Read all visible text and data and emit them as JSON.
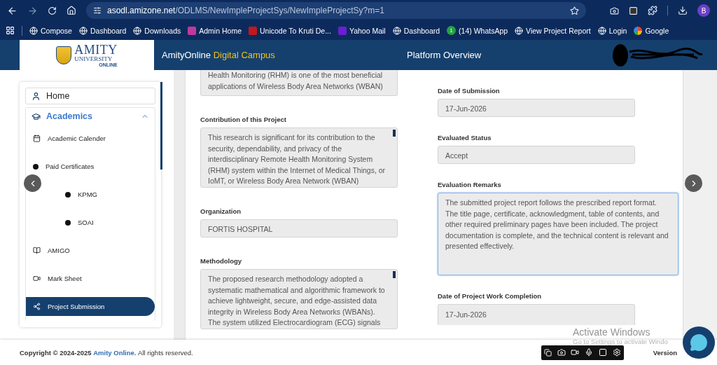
{
  "browser": {
    "url_host": "asodl.amizone.net",
    "url_path": "/ODLMS/NewImpleProjectSys/NewImpleProjectSy?m=1",
    "profile_initial": "B",
    "bookmarks": [
      {
        "label": "Compose",
        "kind": "globe"
      },
      {
        "label": "Dashboard",
        "kind": "globe"
      },
      {
        "label": "Downloads",
        "kind": "globe"
      },
      {
        "label": "Admin Home",
        "kind": "app",
        "color": "#c0399a"
      },
      {
        "label": "Unicode To Kruti De...",
        "kind": "app",
        "color": "#c0181e"
      },
      {
        "label": "Yahoo Mail",
        "kind": "app",
        "color": "#6a1fd1"
      },
      {
        "label": "Dashboard",
        "kind": "globe"
      },
      {
        "label": "(14) WhatsApp",
        "kind": "count",
        "badge": "1"
      },
      {
        "label": "View Project Report",
        "kind": "globe"
      },
      {
        "label": "Login",
        "kind": "globe"
      },
      {
        "label": "Google",
        "kind": "google"
      }
    ]
  },
  "header": {
    "logo_word": "AMITY",
    "logo_sub": "UNIVERSITY",
    "logo_tag": "ONLINE",
    "brand": "AmityOnline",
    "brand_accent": "Digital Campus",
    "title": "Platform Overview"
  },
  "sidebar": {
    "items": [
      {
        "label": "Home",
        "kind": "home",
        "selected": false
      },
      {
        "label": "Academics",
        "kind": "section",
        "selected": false,
        "expanded": true,
        "children": [
          {
            "label": "Academic Calender",
            "kind": "calendar",
            "selected": false
          },
          {
            "label": "Paid Certificates",
            "kind": "dot",
            "selected": false,
            "children": [
              {
                "label": "KPMG",
                "kind": "dot",
                "selected": false
              },
              {
                "label": "SOAI",
                "kind": "dot",
                "selected": false
              }
            ]
          },
          {
            "label": "AMIGO",
            "kind": "book",
            "selected": false
          },
          {
            "label": "Mark Sheet",
            "kind": "video",
            "selected": false
          },
          {
            "label": "Project Submission",
            "kind": "network",
            "selected": true
          }
        ]
      }
    ]
  },
  "form": {
    "left": [
      {
        "kind": "textarea",
        "cut_top": true,
        "lines": [
          "Health Monitoring (RHM) is one of the most beneficial",
          "applications of Wireless Body Area Networks (WBAN)"
        ]
      },
      {
        "kind": "textarea",
        "label": "Contribution of this Project",
        "scrollable": true,
        "lines": [
          "This research is significant for its contribution to the",
          "security, dependability, and privacy of the",
          "interdisciplinary Remote Health Monitoring System",
          "(RHM) system within the Internet of Medical Things, or",
          "IoMT, or Wireless Body Area Network (WBAN)"
        ]
      },
      {
        "kind": "text",
        "label": "Organization",
        "value": "FORTIS HOSPITAL"
      },
      {
        "kind": "textarea",
        "label": "Methodology",
        "scrollable": true,
        "lines": [
          "The proposed research methodology adopted a",
          "systematic mathematical and algorithmic framework to",
          "achieve lightweight, secure, and edge-assisted data",
          "integrity in Wireless Body Area Networks (WBANs).",
          "The system utilized Electrocardiogram (ECG) signals"
        ]
      }
    ],
    "right": [
      {
        "kind": "text",
        "label": "Date of Submission",
        "value": "17-Jun-2026"
      },
      {
        "kind": "text",
        "label": "Evaluated Status",
        "value": "Accept"
      },
      {
        "kind": "textarea",
        "label": "Evaluation Remarks",
        "focused": true,
        "lines": [
          "The submitted project report follows the prescribed report format.",
          "The title page, certificate, acknowledgment, table of contents, and",
          "other required preliminary pages have been included. The project",
          "documentation is complete, and the technical content is relevant and",
          "presented effectively."
        ]
      },
      {
        "kind": "text",
        "label": "Date of Project Work Completion",
        "value": "17-Jun-2026",
        "cut_bottom": true
      }
    ]
  },
  "footer": {
    "copyright": "Copyright © 2024-2025",
    "link": "Amity Online.",
    "rights": "All rights reserved.",
    "version": "Version"
  },
  "windows_notice": {
    "title": "Activate Windows",
    "subtitle": "Go to Settings to activate Windo"
  }
}
